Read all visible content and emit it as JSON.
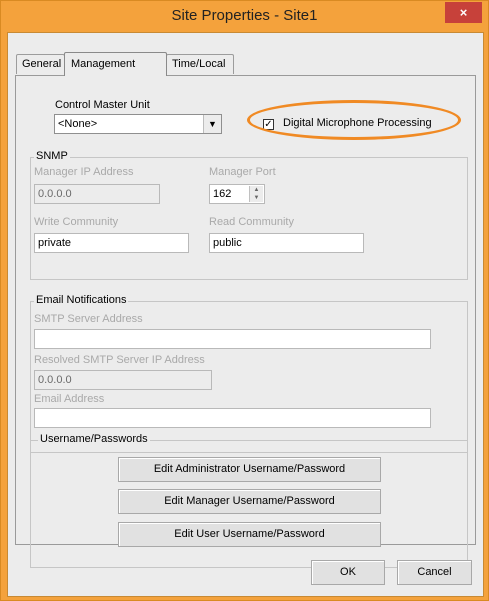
{
  "window": {
    "title": "Site Properties - Site1",
    "close_glyph": "×",
    "colors": {
      "frame": "#f4a23c",
      "close": "#c7413a",
      "highlight": "#f08a24"
    }
  },
  "tabs": [
    "General",
    "Management",
    "Time/Local"
  ],
  "active_tab": "Management",
  "control_master": {
    "label": "Control Master Unit",
    "value": "<None>",
    "dropdown_icon": "chevron-down-icon"
  },
  "digital_mic": {
    "label": "Digital Microphone Processing",
    "checked": true,
    "check_glyph": "✓"
  },
  "snmp": {
    "title": "SNMP",
    "manager_ip_label": "Manager IP Address",
    "manager_ip_value": "0.0.0.0",
    "manager_port_label": "Manager Port",
    "manager_port_value": "162",
    "write_community_label": "Write Community",
    "write_community_value": "private",
    "read_community_label": "Read Community",
    "read_community_value": "public"
  },
  "email": {
    "title": "Email Notifications",
    "smtp_label": "SMTP Server Address",
    "smtp_value": "",
    "resolved_label": "Resolved SMTP Server IP Address",
    "resolved_value": "0.0.0.0",
    "email_label": "Email Address",
    "email_value": ""
  },
  "credentials": {
    "title": "Username/Passwords",
    "admin_button": "Edit Administrator Username/Password",
    "manager_button": "Edit Manager Username/Password",
    "user_button": "Edit User Username/Password"
  },
  "footer": {
    "ok": "OK",
    "cancel": "Cancel"
  }
}
